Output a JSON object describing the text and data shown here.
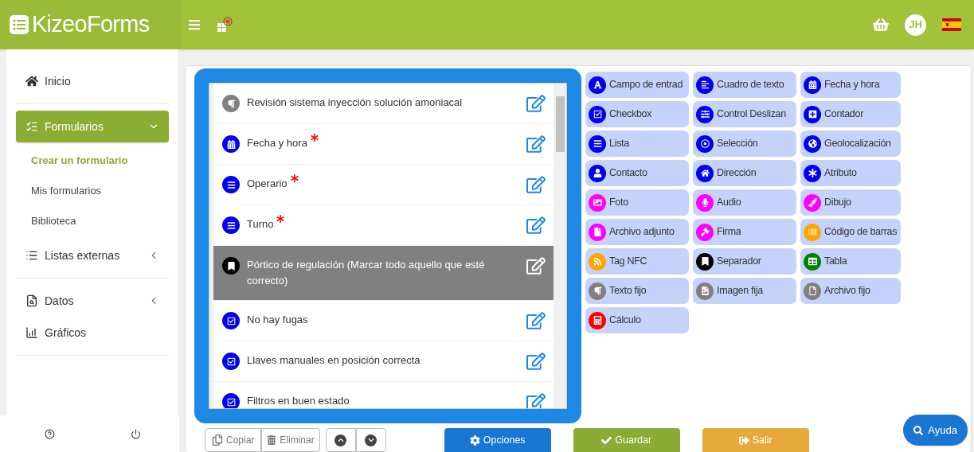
{
  "header": {
    "logo": "KizeoForms",
    "avatar": "JH"
  },
  "sidebar": {
    "sections": [
      {
        "items": [
          {
            "label": "Inicio",
            "kind": "home",
            "selected": false
          }
        ]
      },
      {
        "items": [
          {
            "label": "Formularios",
            "kind": "forms",
            "selected": true,
            "expanded": true,
            "children": [
              {
                "label": "Crear un formulario",
                "selected": true
              },
              {
                "label": "Mis formularios",
                "selected": false
              },
              {
                "label": "Biblioteca",
                "selected": false
              }
            ]
          },
          {
            "label": "Listas externas",
            "kind": "lists",
            "selected": false,
            "expanded": false
          }
        ]
      },
      {
        "items": [
          {
            "label": "Datos",
            "kind": "data",
            "selected": false,
            "expanded": false
          },
          {
            "label": "Gráficos",
            "kind": "charts",
            "selected": false
          }
        ]
      }
    ]
  },
  "fields": [
    {
      "label": "Revisión sistema inyección solución amoniacal",
      "kind": "fixedtext",
      "color": "#808080",
      "required": false,
      "selected": false
    },
    {
      "label": "Fecha y hora",
      "kind": "date",
      "color": "#0000ee",
      "required": true,
      "selected": false
    },
    {
      "label": "Operario",
      "kind": "list",
      "color": "#0000ee",
      "required": true,
      "selected": false
    },
    {
      "label": "Turno",
      "kind": "list",
      "color": "#0000ee",
      "required": true,
      "selected": false
    },
    {
      "label": "Pórtico de regulación (Marcar todo aquello que esté correcto)",
      "kind": "separator",
      "color": "#000000",
      "required": false,
      "selected": true
    },
    {
      "label": "No hay fugas",
      "kind": "checkbox",
      "color": "#0000ee",
      "required": false,
      "selected": false
    },
    {
      "label": "Llaves manuales en posición correcta",
      "kind": "checkbox",
      "color": "#0000ee",
      "required": false,
      "selected": false
    },
    {
      "label": "Filtros en buen estado",
      "kind": "checkbox",
      "color": "#0000ee",
      "required": false,
      "selected": false
    }
  ],
  "palette": [
    {
      "label": "Campo de entrad",
      "kind": "text",
      "color": "#0000ee"
    },
    {
      "label": "Cuadro de texto",
      "kind": "textarea",
      "color": "#0000ee"
    },
    {
      "label": "Fecha y hora",
      "kind": "date",
      "color": "#0000ee"
    },
    {
      "label": "Checkbox",
      "kind": "checkbox",
      "color": "#0000ee"
    },
    {
      "label": "Control Deslizan",
      "kind": "slider",
      "color": "#0000ee"
    },
    {
      "label": "Contador",
      "kind": "counter",
      "color": "#0000ee"
    },
    {
      "label": "Lista",
      "kind": "list",
      "color": "#0000ee"
    },
    {
      "label": "Selección",
      "kind": "choice",
      "color": "#0000ee"
    },
    {
      "label": "Geolocalización",
      "kind": "geo",
      "color": "#0000ee"
    },
    {
      "label": "Contacto",
      "kind": "contact",
      "color": "#0000ee"
    },
    {
      "label": "Dirección",
      "kind": "address",
      "color": "#0000ee"
    },
    {
      "label": "Atributo",
      "kind": "attribute",
      "color": "#0000ee"
    },
    {
      "label": "Foto",
      "kind": "photo",
      "color": "#ff00ff"
    },
    {
      "label": "Audio",
      "kind": "audio",
      "color": "#ff00ff"
    },
    {
      "label": "Dibujo",
      "kind": "drawing",
      "color": "#ff00ff"
    },
    {
      "label": "Archivo adjunto",
      "kind": "attachment",
      "color": "#ff00ff"
    },
    {
      "label": "Firma",
      "kind": "signature",
      "color": "#ff00ff"
    },
    {
      "label": "Código de barras",
      "kind": "barcode",
      "color": "#ffa500"
    },
    {
      "label": "Tag NFC",
      "kind": "nfc",
      "color": "#ffa500"
    },
    {
      "label": "Separador",
      "kind": "separator",
      "color": "#000000"
    },
    {
      "label": "Tabla",
      "kind": "table",
      "color": "#008000"
    },
    {
      "label": "Texto fijo",
      "kind": "fixedtext",
      "color": "#808080"
    },
    {
      "label": "Imagen fija",
      "kind": "fixedimage",
      "color": "#808080"
    },
    {
      "label": "Archivo fijo",
      "kind": "fixedfile",
      "color": "#808080"
    },
    {
      "label": "Cálculo",
      "kind": "calc",
      "color": "#ff0000"
    }
  ],
  "toolbar": {
    "copy": "Copiar",
    "delete": "Eliminar",
    "options": "Opciones",
    "save": "Guardar",
    "exit": "Salir"
  },
  "help": "Ayuda"
}
